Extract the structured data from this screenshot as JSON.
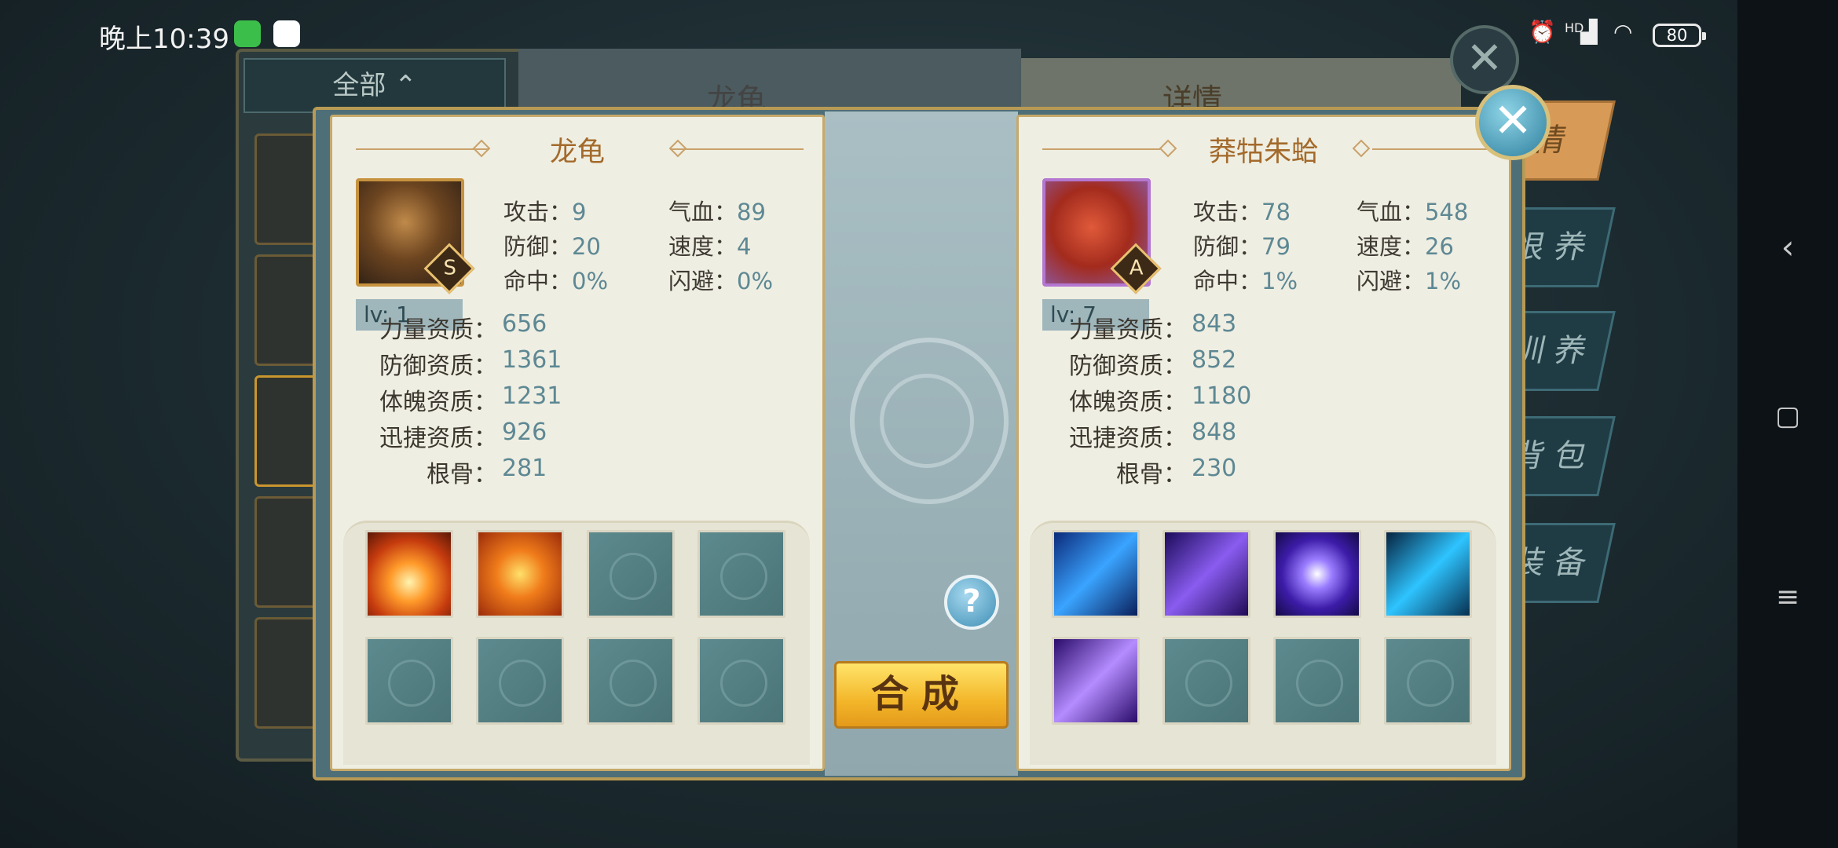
{
  "status_bar": {
    "time": "晚上10:39",
    "signal": "HD",
    "battery": "80"
  },
  "background": {
    "filter_label": "全部",
    "center_title": "龙龟",
    "detail_title": "详情",
    "side_tabs": [
      "情",
      "恨 养",
      "训 养",
      "背 包",
      "装 备"
    ]
  },
  "left_pet": {
    "name": "龙龟",
    "rank": "S",
    "level": "lv: 1",
    "attack_label": "攻击：",
    "attack": "9",
    "hp_label": "气血：",
    "hp": "89",
    "defense_label": "防御：",
    "defense": "20",
    "speed_label": "速度：",
    "speed": "4",
    "hit_label": "命中：",
    "hit": "0%",
    "dodge_label": "闪避：",
    "dodge": "0%",
    "str_apt_label": "力量资质：",
    "str_apt": "656",
    "def_apt_label": "防御资质：",
    "def_apt": "1361",
    "con_apt_label": "体魄资质：",
    "con_apt": "1231",
    "agi_apt_label": "迅捷资质：",
    "agi_apt": "926",
    "bone_label": "根骨：",
    "bone": "281",
    "skills": [
      "flame-orb-skill",
      "flame-shield-skill",
      "empty",
      "empty",
      "empty",
      "empty",
      "empty",
      "empty"
    ]
  },
  "right_pet": {
    "name": "莽牯朱蛤",
    "rank": "A",
    "level": "lv: 7",
    "attack_label": "攻击：",
    "attack": "78",
    "hp_label": "气血：",
    "hp": "548",
    "defense_label": "防御：",
    "defense": "79",
    "speed_label": "速度：",
    "speed": "26",
    "hit_label": "命中：",
    "hit": "1%",
    "dodge_label": "闪避：",
    "dodge": "1%",
    "str_apt_label": "力量资质：",
    "str_apt": "843",
    "def_apt_label": "防御资质：",
    "def_apt": "852",
    "con_apt_label": "体魄资质：",
    "con_apt": "1180",
    "agi_apt_label": "迅捷资质：",
    "agi_apt": "848",
    "bone_label": "根骨：",
    "bone": "230",
    "skills": [
      "lightning-strike-skill",
      "arcane-pillar-skill",
      "arcane-orb-skill",
      "frost-beast-skill",
      "arcane-slash-skill",
      "empty",
      "empty",
      "empty"
    ]
  },
  "actions": {
    "compose": "合成",
    "help": "?",
    "close": "✕"
  }
}
